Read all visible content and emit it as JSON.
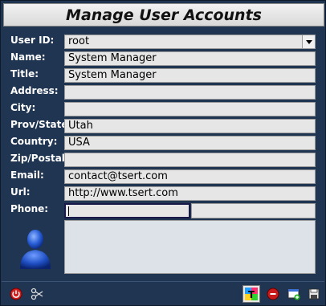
{
  "window": {
    "title": "Manage User Accounts"
  },
  "form": {
    "user_id": {
      "label": "User ID:",
      "value": "root"
    },
    "name": {
      "label": "Name:",
      "value": "System Manager"
    },
    "title": {
      "label": "Title:",
      "value": "System Manager"
    },
    "address": {
      "label": "Address:",
      "value": ""
    },
    "city": {
      "label": "City:",
      "value": ""
    },
    "prov_state": {
      "label": "Prov/State:",
      "value": "Utah"
    },
    "country": {
      "label": "Country:",
      "value": "USA"
    },
    "zip": {
      "label": "Zip/Postal:",
      "value": ""
    },
    "email": {
      "label": "Email:",
      "value": "contact@tsert.com"
    },
    "url": {
      "label": "Url:",
      "value": "http://www.tsert.com"
    },
    "phone": {
      "label": "Phone:",
      "value1": "",
      "value2": ""
    }
  },
  "icons": {
    "avatar": "user-avatar-icon",
    "toolbar_left": [
      "power-icon",
      "scissors-icon"
    ],
    "toolbar_right": [
      "multicolor-app-icon",
      "stop-icon",
      "new-window-icon",
      "save-icon"
    ]
  },
  "colors": {
    "background": "#1f3552",
    "field": "#e6e6e6",
    "label": "#ffffff",
    "title_bar": "#e6e6e6",
    "avatar": "#2a5fd8"
  }
}
